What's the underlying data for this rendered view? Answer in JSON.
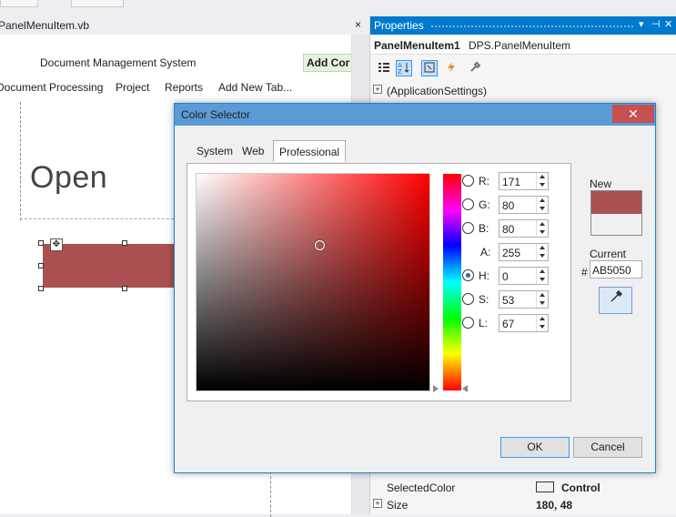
{
  "document_tab": {
    "title": "PanelMenuItem.vb",
    "close": "×"
  },
  "designer": {
    "app_title": "Document Management System",
    "add_control": "Add Cor",
    "menu": [
      "Document Processing",
      "Project",
      "Reports",
      "Add New Tab..."
    ],
    "open_label": "Open",
    "panel_color": "#ab5050",
    "move_glyph": "✥"
  },
  "properties": {
    "title": "Properties",
    "head_buttons": [
      "▾",
      "⊣",
      "✕"
    ],
    "object_name": "PanelMenuItem1",
    "object_type": "DPS.PanelMenuItem",
    "toolbar_icons": [
      "categorized-icon",
      "alphabetical-icon",
      "properties-icon",
      "events-icon",
      "property-pages-icon"
    ],
    "rows": [
      {
        "expand": "+",
        "name": "(ApplicationSettings)",
        "value": ""
      },
      {
        "expand": "",
        "name": "SelectedColor",
        "value": "Control"
      },
      {
        "expand": "+",
        "name": "Size",
        "value": "180, 48"
      }
    ]
  },
  "dialog": {
    "title": "Color Selector",
    "close": "✕",
    "tabs": [
      "System",
      "Web",
      "Professional"
    ],
    "active_tab": "Professional",
    "fields": [
      {
        "label": "R:",
        "value": "171",
        "radio": true,
        "checked": false
      },
      {
        "label": "G:",
        "value": "80",
        "radio": true,
        "checked": false
      },
      {
        "label": "B:",
        "value": "80",
        "radio": true,
        "checked": false
      },
      {
        "label": "A:",
        "value": "255",
        "radio": false,
        "checked": false
      },
      {
        "label": "H:",
        "value": "0",
        "radio": true,
        "checked": true
      },
      {
        "label": "S:",
        "value": "53",
        "radio": true,
        "checked": false
      },
      {
        "label": "L:",
        "value": "67",
        "radio": true,
        "checked": false
      }
    ],
    "new_label": "New",
    "current_label": "Current",
    "new_color": "#ab5050",
    "current_color": "#f0f0f0",
    "hex_prefix": "#",
    "hex_value": "AB5050",
    "picker_glyph": "✎",
    "saturation": 0.53,
    "brightness": 0.67,
    "ok": "OK",
    "cancel": "Cancel"
  }
}
